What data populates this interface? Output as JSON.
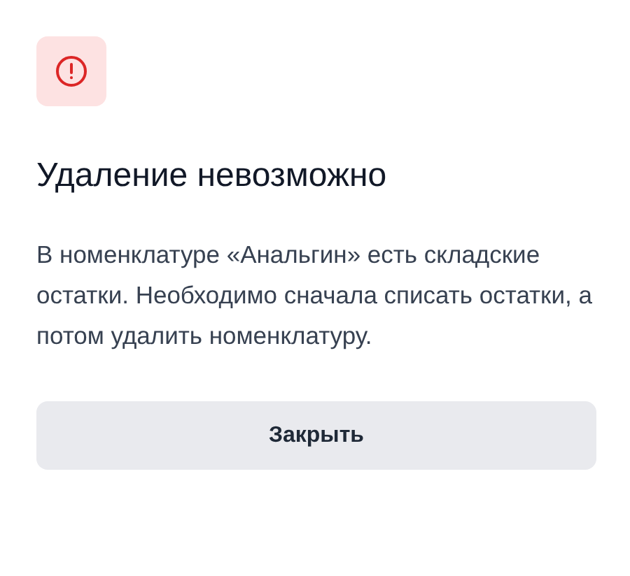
{
  "dialog": {
    "title": "Удаление невозможно",
    "message": "В номенклатуре «Анальгин» есть складские остатки. Необходимо сначала списать остатки, а потом удалить номенклатуру.",
    "buttons": [
      "Закрыть"
    ]
  }
}
